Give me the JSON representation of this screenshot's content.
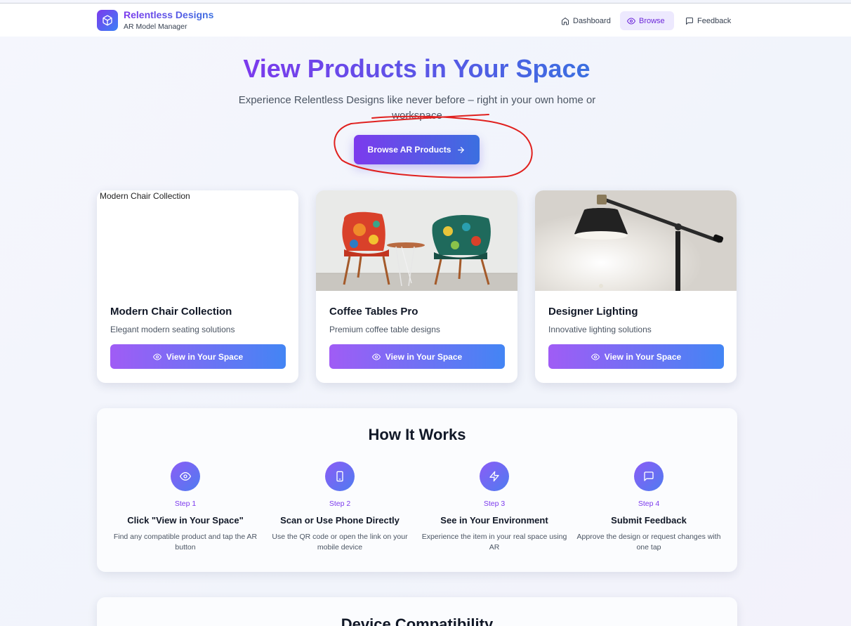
{
  "brand": {
    "name": "Relentless Designs",
    "subtitle": "AR Model Manager",
    "icon": "cube-icon"
  },
  "nav": {
    "items": [
      {
        "label": "Dashboard",
        "icon": "home-icon",
        "active": false
      },
      {
        "label": "Browse",
        "icon": "eye-icon",
        "active": true
      },
      {
        "label": "Feedback",
        "icon": "message-square-icon",
        "active": false
      }
    ]
  },
  "hero": {
    "title": "View Products in Your Space",
    "subtitle": "Experience Relentless Designs like never before – right in your own home or workspace",
    "cta_label": "Browse AR Products",
    "cta_icon": "arrow-right-icon"
  },
  "annotation": {
    "color": "#e0201e",
    "shape": "freehand-ellipse-around-cta"
  },
  "products": [
    {
      "title": "Modern Chair Collection",
      "description": "Elegant modern seating solutions",
      "image_alt": "Modern Chair Collection",
      "button_label": "View in Your Space"
    },
    {
      "title": "Coffee Tables Pro",
      "description": "Premium coffee table designs",
      "image_alt": "Coffee Tables Pro",
      "button_label": "View in Your Space"
    },
    {
      "title": "Designer Lighting",
      "description": "Innovative lighting solutions",
      "image_alt": "Designer Lighting",
      "button_label": "View in Your Space"
    }
  ],
  "how_it_works": {
    "title": "How It Works",
    "steps": [
      {
        "icon": "eye-icon",
        "step": "Step 1",
        "title": "Click \"View in Your Space\"",
        "description": "Find any compatible product and tap the AR button"
      },
      {
        "icon": "smartphone-icon",
        "step": "Step 2",
        "title": "Scan or Use Phone Directly",
        "description": "Use the QR code or open the link on your mobile device"
      },
      {
        "icon": "zap-icon",
        "step": "Step 3",
        "title": "See in Your Environment",
        "description": "Experience the item in your real space using AR"
      },
      {
        "icon": "message-square-icon",
        "step": "Step 4",
        "title": "Submit Feedback",
        "description": "Approve the design or request changes with one tap"
      }
    ]
  },
  "compatibility": {
    "title": "Device Compatibility"
  },
  "colors": {
    "accent_purple": "#7c3aed",
    "accent_blue": "#3b82f6",
    "active_nav_bg": "#ede9fe"
  }
}
